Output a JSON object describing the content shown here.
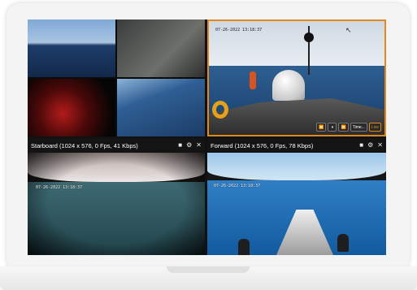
{
  "device": {
    "type": "laptop"
  },
  "camera_grid": {
    "top_left": {
      "sub_feeds": [
        "deck-crew",
        "winch-spool",
        "control-room-red",
        "deck-hatch"
      ]
    },
    "top_right": {
      "timestamp": "07-26-2022 13:18:37",
      "selected": true,
      "accent_color": "#e08a1e",
      "controls": {
        "rewind_icon": "⏪",
        "pause_icon": "⏸",
        "forward_icon": "⏩",
        "time_label": "Time...",
        "live_label": "Live"
      }
    },
    "starboard": {
      "title": "Starboard (1024 x 576, 0 Fps, 41 Kbps)",
      "timestamp": "07-26-2022 13:18:37",
      "icons": {
        "camera": "■",
        "settings": "⚙",
        "close": "✕"
      }
    },
    "forward": {
      "title": "Forward (1024 x 576, 0 Fps, 78 Kbps)",
      "timestamp": "07-26-2022 13:18:37",
      "icons": {
        "camera": "■",
        "settings": "⚙",
        "close": "✕"
      }
    }
  }
}
